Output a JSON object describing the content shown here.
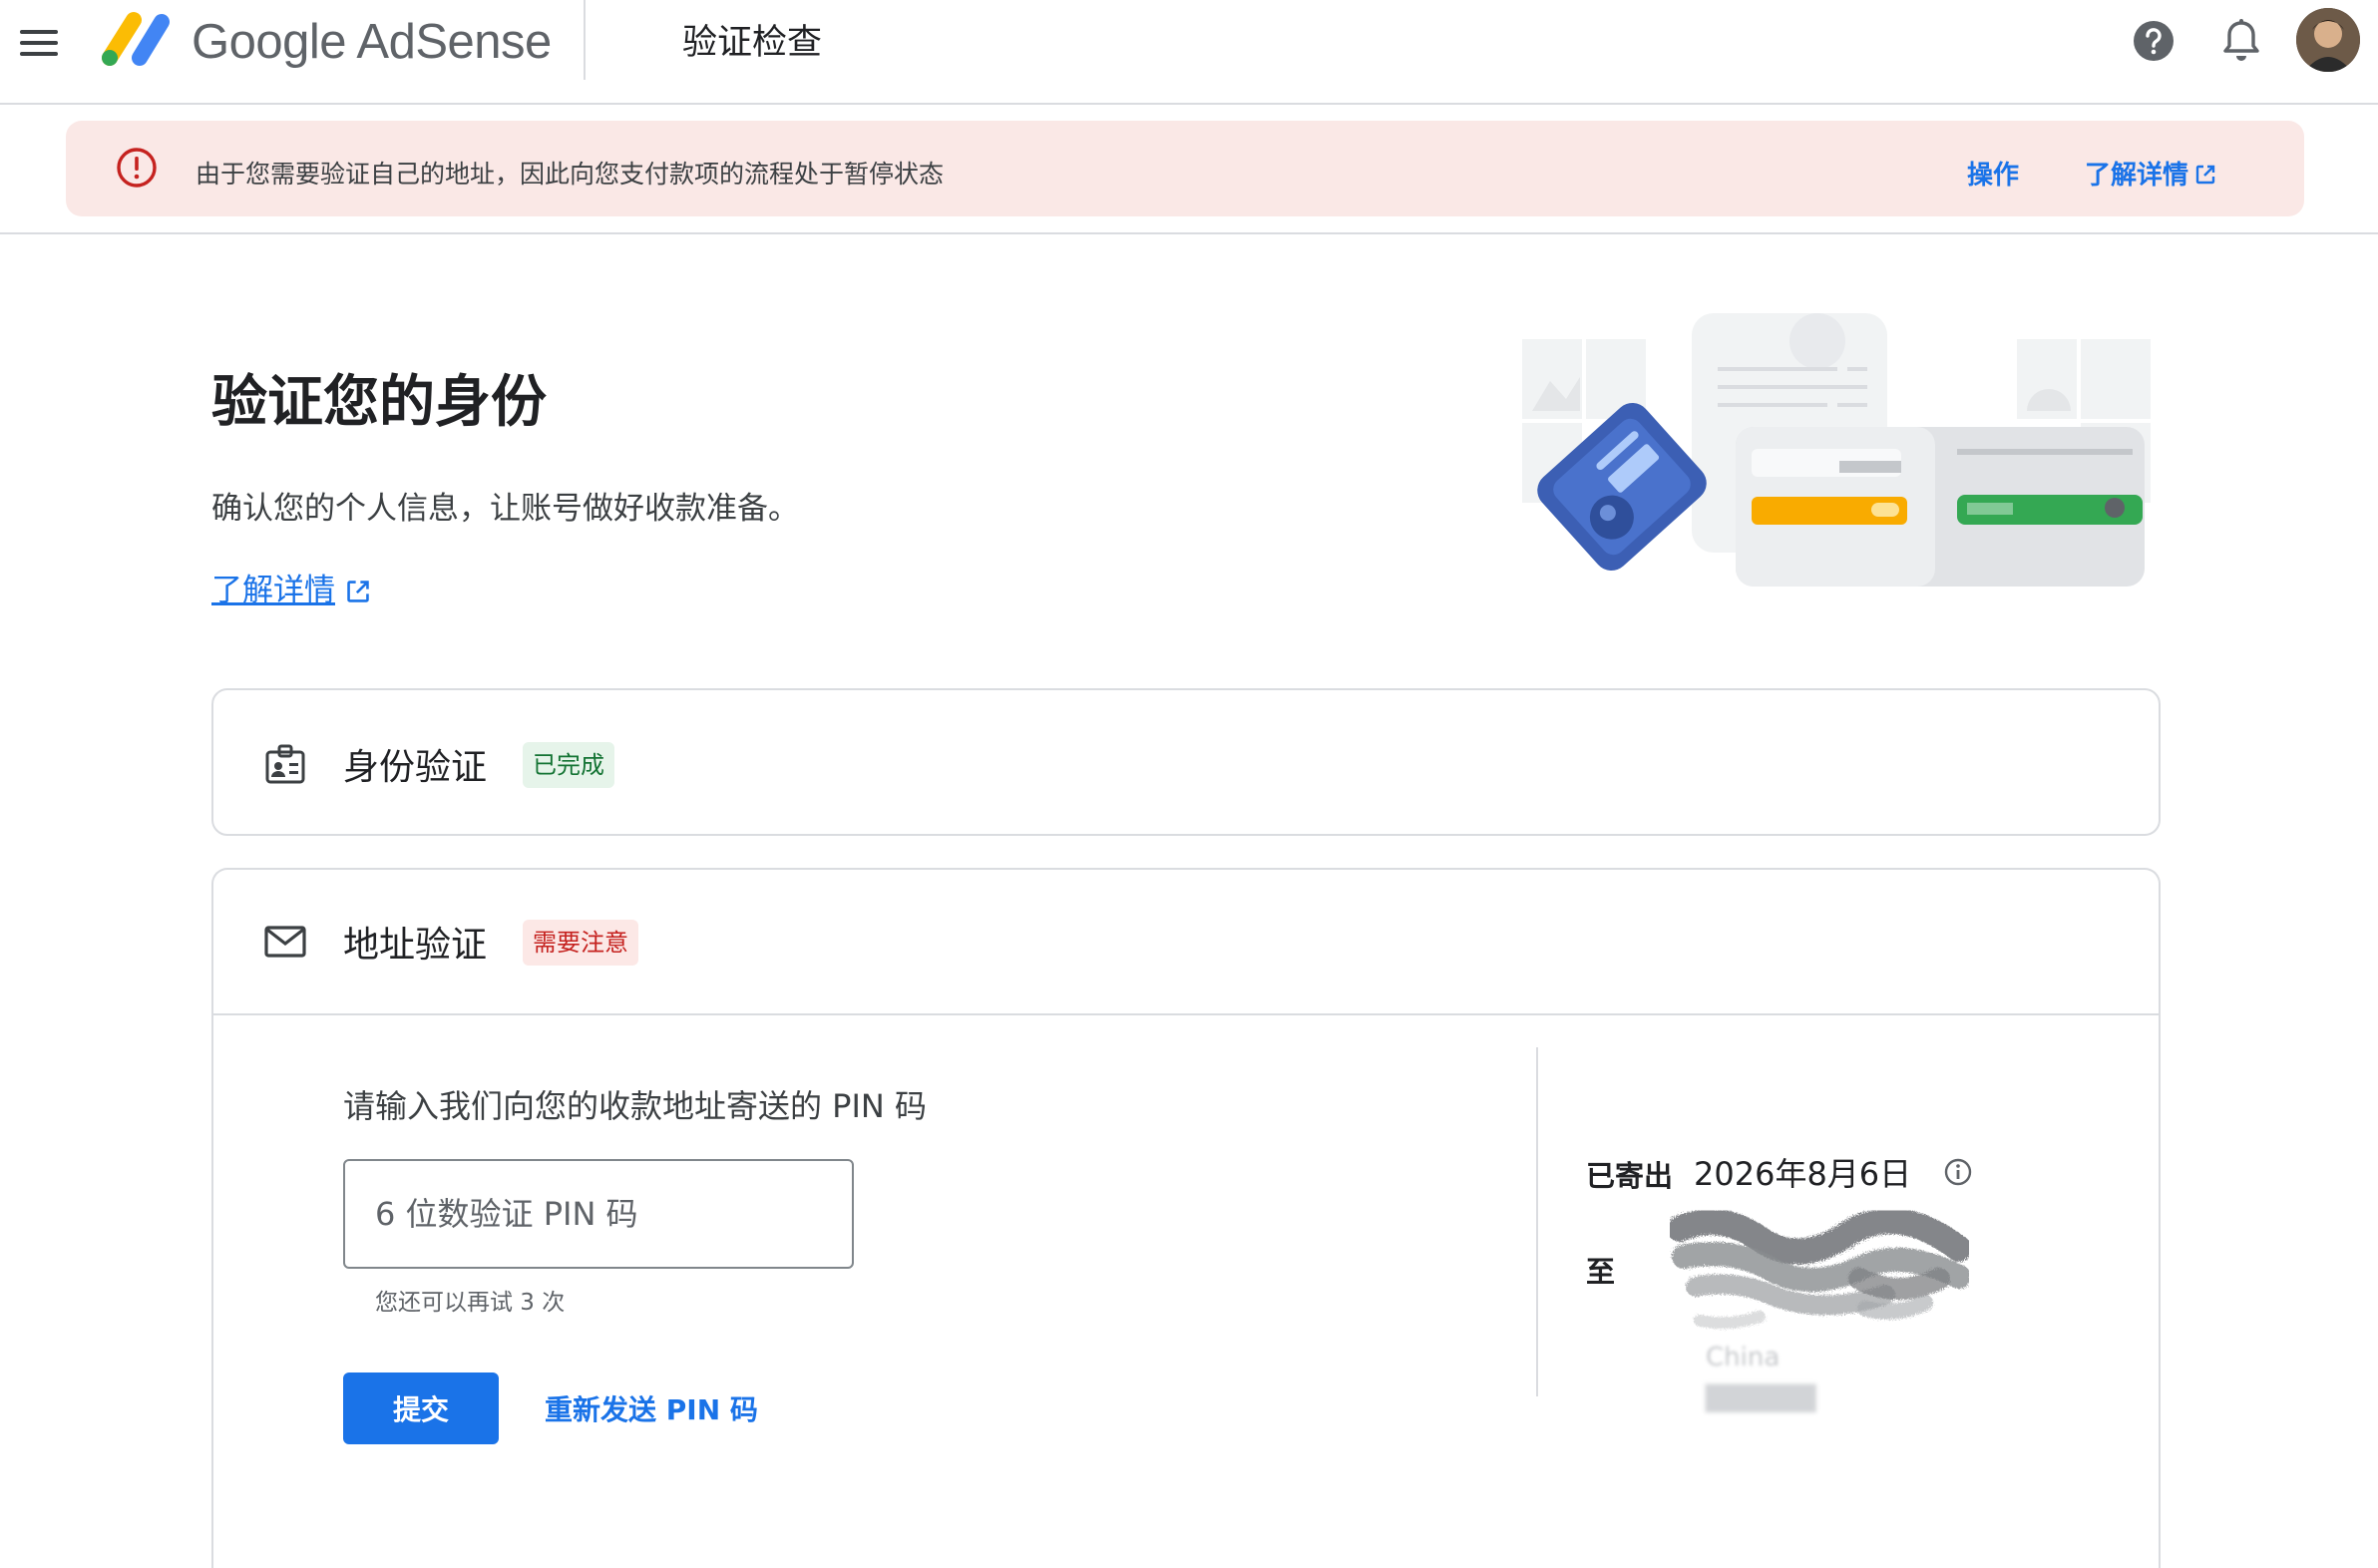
{
  "app": {
    "brand": "Google AdSense",
    "page_heading": "验证检查"
  },
  "alert": {
    "message": "由于您需要验证自己的地址，因此向您支付款项的流程处于暂停状态",
    "action_label": "操作",
    "learn_more_label": "了解详情"
  },
  "hero": {
    "title": "验证您的身份",
    "subtitle": "确认您的个人信息，让账号做好收款准备。",
    "learn_more_label": "了解详情"
  },
  "identity_card": {
    "title": "身份验证",
    "status": "已完成"
  },
  "address_card": {
    "title": "地址验证",
    "status": "需要注意",
    "pin_prompt": "请输入我们向您的收款地址寄送的 PIN 码",
    "pin_placeholder": "6 位数验证 PIN 码",
    "pin_value": "",
    "retry_hint": "您还可以再试 3 次",
    "submit_label": "提交",
    "resend_label": "重新发送 PIN 码",
    "sent_label": "已寄出",
    "sent_date": "2026年8月6日",
    "to_label": "至",
    "address_country": "China"
  },
  "colors": {
    "accent": "#1a73e8",
    "alert_background": "#fae8e6",
    "alert_icon": "#c5221f",
    "success_chip": "#e6f4ea",
    "warning_chip": "#fce8e6"
  },
  "icons": {
    "menu": "menu-icon",
    "help": "help-icon",
    "notifications": "bell-icon",
    "alert": "error-circle-icon",
    "external_link": "external-link-icon",
    "identity": "id-badge-icon",
    "address": "mail-icon",
    "info": "info-icon"
  }
}
